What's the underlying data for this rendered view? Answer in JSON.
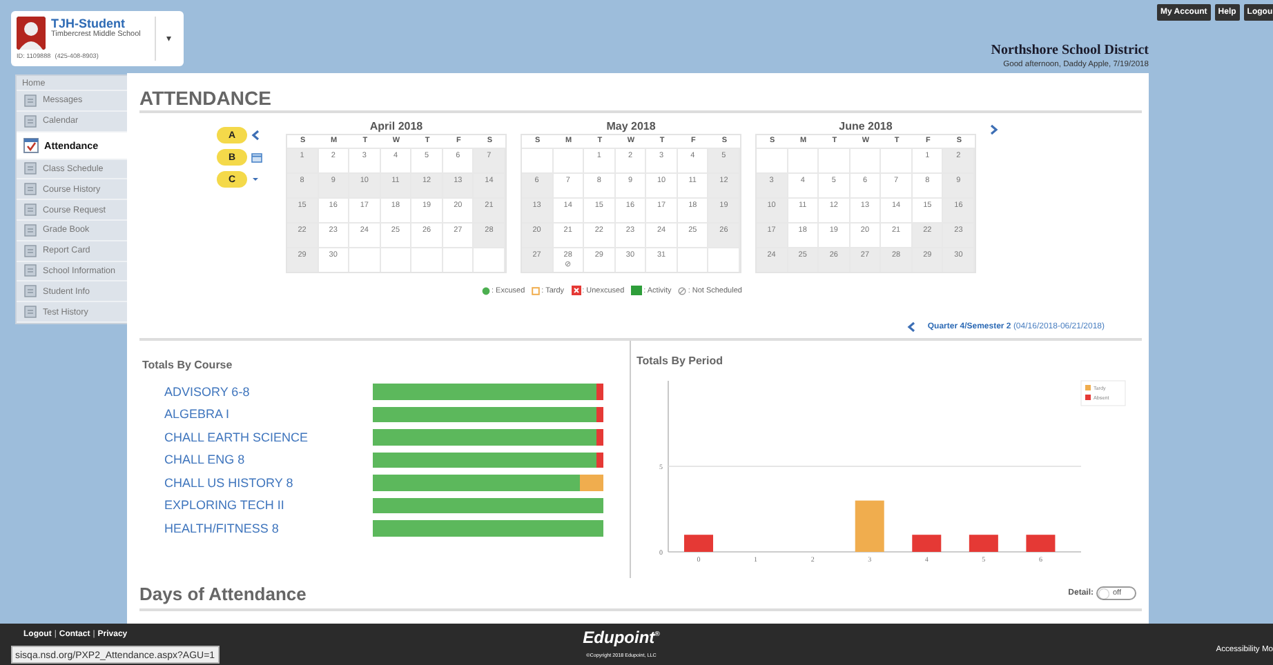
{
  "header": {
    "student_name": "TJH-Student",
    "school": "Timbercrest Middle School",
    "student_id": "ID: 1109888",
    "phone": "(425-408-8903)",
    "menu_caret": "▾",
    "district": "Northshore School District",
    "greeting": "Good afternoon, Daddy Apple, 7/19/2018"
  },
  "top_buttons": [
    "My Account",
    "Help",
    "Logou"
  ],
  "sidebar": {
    "items": [
      {
        "label": "Home",
        "kind": "heading",
        "selected": false
      },
      {
        "label": "Messages",
        "kind": "link",
        "selected": false
      },
      {
        "label": "Calendar",
        "kind": "link",
        "selected": false
      },
      {
        "label": "Attendance",
        "kind": "link",
        "selected": true
      },
      {
        "label": "Class Schedule",
        "kind": "link",
        "selected": false
      },
      {
        "label": "Course History",
        "kind": "link",
        "selected": false
      },
      {
        "label": "Course Request",
        "kind": "link",
        "selected": false
      },
      {
        "label": "Grade Book",
        "kind": "link",
        "selected": false
      },
      {
        "label": "Report Card",
        "kind": "link",
        "selected": false
      },
      {
        "label": "School Information",
        "kind": "link",
        "selected": false
      },
      {
        "label": "Student Info",
        "kind": "link",
        "selected": false
      },
      {
        "label": "Test History",
        "kind": "link",
        "selected": false
      }
    ]
  },
  "page_title": "ATTENDANCE",
  "calendar": {
    "callouts": [
      {
        "label": "A",
        "kind": "prev"
      },
      {
        "label": "B",
        "kind": "calendar"
      },
      {
        "label": "C",
        "kind": "dropdown"
      }
    ],
    "months": [
      {
        "title": "April 2018",
        "weekdays": [
          "S",
          "M",
          "T",
          "W",
          "T",
          "F",
          "S"
        ],
        "weeks": [
          [
            {
              "d": "1",
              "off": true
            },
            {
              "d": "2",
              "off": false
            },
            {
              "d": "3",
              "off": false
            },
            {
              "d": "4",
              "off": false
            },
            {
              "d": "5",
              "off": false
            },
            {
              "d": "6",
              "off": false
            },
            {
              "d": "7",
              "off": true
            }
          ],
          [
            {
              "d": "8",
              "off": true
            },
            {
              "d": "9",
              "off": true
            },
            {
              "d": "10",
              "off": true
            },
            {
              "d": "11",
              "off": true
            },
            {
              "d": "12",
              "off": true
            },
            {
              "d": "13",
              "off": true
            },
            {
              "d": "14",
              "off": true
            }
          ],
          [
            {
              "d": "15",
              "off": true
            },
            {
              "d": "16",
              "off": false
            },
            {
              "d": "17",
              "off": false
            },
            {
              "d": "18",
              "off": false
            },
            {
              "d": "19",
              "off": false
            },
            {
              "d": "20",
              "off": false
            },
            {
              "d": "21",
              "off": true
            }
          ],
          [
            {
              "d": "22",
              "off": true
            },
            {
              "d": "23",
              "off": false
            },
            {
              "d": "24",
              "off": false
            },
            {
              "d": "25",
              "off": false
            },
            {
              "d": "26",
              "off": false
            },
            {
              "d": "27",
              "off": false
            },
            {
              "d": "28",
              "off": true
            }
          ],
          [
            {
              "d": "29",
              "off": true
            },
            {
              "d": "30",
              "off": false
            }
          ]
        ]
      },
      {
        "title": "May 2018",
        "weekdays": [
          "S",
          "M",
          "T",
          "W",
          "T",
          "F",
          "S"
        ],
        "weeks": [
          [
            {
              "d": "1",
              "off": false
            },
            {
              "d": "2",
              "off": false
            },
            {
              "d": "3",
              "off": false
            },
            {
              "d": "4",
              "off": false
            },
            {
              "d": "5",
              "off": true
            }
          ],
          [
            {
              "d": "6",
              "off": true
            },
            {
              "d": "7",
              "off": false
            },
            {
              "d": "8",
              "off": false
            },
            {
              "d": "9",
              "off": false
            },
            {
              "d": "10",
              "off": false
            },
            {
              "d": "11",
              "off": false
            },
            {
              "d": "12",
              "off": true
            }
          ],
          [
            {
              "d": "13",
              "off": true
            },
            {
              "d": "14",
              "off": false
            },
            {
              "d": "15",
              "off": false
            },
            {
              "d": "16",
              "off": false
            },
            {
              "d": "17",
              "off": false
            },
            {
              "d": "18",
              "off": false
            },
            {
              "d": "19",
              "off": true
            }
          ],
          [
            {
              "d": "20",
              "off": true
            },
            {
              "d": "21",
              "off": false
            },
            {
              "d": "22",
              "off": false
            },
            {
              "d": "23",
              "off": false
            },
            {
              "d": "24",
              "off": false
            },
            {
              "d": "25",
              "off": false
            },
            {
              "d": "26",
              "off": true
            }
          ],
          [
            {
              "d": "27",
              "off": true
            },
            {
              "d": "28",
              "off": false,
              "mark": "⊘"
            },
            {
              "d": "29",
              "off": false
            },
            {
              "d": "30",
              "off": false
            },
            {
              "d": "31",
              "off": false
            }
          ]
        ]
      },
      {
        "title": "June 2018",
        "weekdays": [
          "S",
          "M",
          "T",
          "W",
          "T",
          "F",
          "S"
        ],
        "weeks": [
          [
            {
              "d": "1",
              "off": false
            },
            {
              "d": "2",
              "off": true
            }
          ],
          [
            {
              "d": "3",
              "off": true
            },
            {
              "d": "4",
              "off": false
            },
            {
              "d": "5",
              "off": false
            },
            {
              "d": "6",
              "off": false
            },
            {
              "d": "7",
              "off": false
            },
            {
              "d": "8",
              "off": false
            },
            {
              "d": "9",
              "off": true
            }
          ],
          [
            {
              "d": "10",
              "off": true
            },
            {
              "d": "11",
              "off": false
            },
            {
              "d": "12",
              "off": false
            },
            {
              "d": "13",
              "off": false
            },
            {
              "d": "14",
              "off": false
            },
            {
              "d": "15",
              "off": false
            },
            {
              "d": "16",
              "off": true
            }
          ],
          [
            {
              "d": "17",
              "off": true
            },
            {
              "d": "18",
              "off": false
            },
            {
              "d": "19",
              "off": false
            },
            {
              "d": "20",
              "off": false
            },
            {
              "d": "21",
              "off": false
            },
            {
              "d": "22",
              "off": true
            },
            {
              "d": "23",
              "off": true
            }
          ],
          [
            {
              "d": "24",
              "off": true
            },
            {
              "d": "25",
              "off": true
            },
            {
              "d": "26",
              "off": true
            },
            {
              "d": "27",
              "off": true
            },
            {
              "d": "28",
              "off": true
            },
            {
              "d": "29",
              "off": true
            },
            {
              "d": "30",
              "off": true
            }
          ]
        ]
      }
    ],
    "legend": [
      {
        "label": ": Excused",
        "kind": "excused",
        "color": "#4caf50"
      },
      {
        "label": ": Tardy",
        "kind": "tardy",
        "color": "#f0ad4e"
      },
      {
        "label": ": Unexcused",
        "kind": "unexcused",
        "color": "#e53935"
      },
      {
        "label": ": Activity",
        "kind": "activity",
        "color": "#2e9e3a"
      },
      {
        "label": ": Not Scheduled",
        "kind": "not_scheduled",
        "color": "#999999"
      }
    ],
    "quarter": {
      "label": "Quarter 4/Semester 2",
      "range": "(04/16/2018-06/21/2018)"
    }
  },
  "courses": {
    "title": "Totals By Course",
    "items": [
      {
        "name": "ADVISORY 6-8",
        "level": 0.97,
        "color": "#e53935"
      },
      {
        "name": "ALGEBRA I",
        "level": 0.97,
        "color": "#e53935"
      },
      {
        "name": "CHALL EARTH SCIENCE",
        "level": 0.97,
        "color": "#e53935"
      },
      {
        "name": "CHALL ENG 8",
        "level": 0.97,
        "color": "#e53935"
      },
      {
        "name": "CHALL US HISTORY 8",
        "level": 0.9,
        "color": "#f0ad4e"
      },
      {
        "name": "EXPLORING TECH II",
        "level": 1
      },
      {
        "name": "HEALTH/FITNESS 8",
        "level": 1
      }
    ]
  },
  "periods": {
    "title": "Totals By Period",
    "chart_data": {
      "type": "bar",
      "stacked": true,
      "legend": "upper right",
      "categories": [
        "0",
        "1",
        "2",
        "3",
        "4",
        "5",
        "6"
      ],
      "ylim": [
        0,
        10
      ],
      "yticks": [
        0,
        5
      ],
      "series": [
        {
          "name": "Tardy",
          "color": "#f0ad4e",
          "values": [
            0,
            0,
            0,
            3,
            0,
            0,
            0
          ]
        },
        {
          "name": "Absent",
          "color": "#e53935",
          "values": [
            1,
            0,
            0,
            0,
            1,
            1,
            1
          ]
        }
      ]
    }
  },
  "days": {
    "title": "Days of Attendance",
    "detail_label": "Detail:",
    "detail_toggle": {
      "on": false,
      "label": "off"
    }
  },
  "footer": {
    "links": [
      {
        "text": "Logout",
        "kind": "link"
      },
      {
        "text": "|",
        "kind": "separator"
      },
      {
        "text": "Contact",
        "kind": "link"
      },
      {
        "text": "|",
        "kind": "separator"
      },
      {
        "text": "Privacy",
        "kind": "link"
      }
    ],
    "logo": "Edupoint$^{®}$",
    "copyright": "©Copyright 2018 Edupoint, LLC",
    "accessibility": "Accessibility Mo",
    "status_url": "sisqa.nsd.org/PXP2_Attendance.aspx?AGU=1"
  }
}
